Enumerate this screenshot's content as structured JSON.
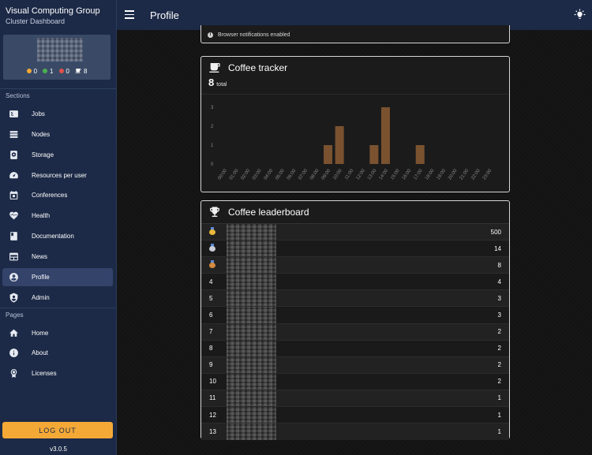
{
  "sidebar": {
    "title": "Visual Computing Group",
    "subtitle": "Cluster Dashboard",
    "status": [
      {
        "icon": "orange-dot",
        "color": "#f4a936",
        "value": "0"
      },
      {
        "icon": "green-dot",
        "color": "#4caf50",
        "value": "1"
      },
      {
        "icon": "red-dot",
        "color": "#e0504a",
        "value": "0"
      },
      {
        "icon": "coffee-icon",
        "value": "8"
      }
    ],
    "sections_label": "Sections",
    "sections": [
      {
        "label": "Jobs",
        "icon": "jobs-icon"
      },
      {
        "label": "Nodes",
        "icon": "nodes-icon"
      },
      {
        "label": "Storage",
        "icon": "storage-icon"
      },
      {
        "label": "Resources per user",
        "icon": "gauge-icon"
      },
      {
        "label": "Conferences",
        "icon": "calendar-icon"
      },
      {
        "label": "Health",
        "icon": "heart-pulse-icon"
      },
      {
        "label": "Documentation",
        "icon": "book-icon"
      },
      {
        "label": "News",
        "icon": "news-icon"
      },
      {
        "label": "Profile",
        "icon": "account-circle-icon"
      },
      {
        "label": "Admin",
        "icon": "shield-icon"
      }
    ],
    "pages_label": "Pages",
    "pages": [
      {
        "label": "Home",
        "icon": "home-icon"
      },
      {
        "label": "About",
        "icon": "info-icon"
      },
      {
        "label": "Licenses",
        "icon": "certificate-icon"
      }
    ],
    "logout_label": "LOG OUT",
    "version": "v3.0.5"
  },
  "header": {
    "title": "Profile",
    "menu_icon": "menu-icon",
    "theme_icon": "lightbulb-icon"
  },
  "notifications": {
    "text": "Browser notifications enabled"
  },
  "coffee_tracker": {
    "title": "Coffee tracker",
    "total": "8",
    "total_label": "total"
  },
  "chart_data": {
    "type": "bar",
    "title": "",
    "xlabel": "",
    "ylabel": "",
    "ylim": [
      0,
      3
    ],
    "yticks": [
      0,
      1,
      2,
      3
    ],
    "categories": [
      "00:00",
      "01:00",
      "02:00",
      "03:00",
      "04:00",
      "05:00",
      "06:00",
      "07:00",
      "08:00",
      "09:00",
      "10:00",
      "11:00",
      "12:00",
      "13:00",
      "14:00",
      "15:00",
      "16:00",
      "17:00",
      "18:00",
      "19:00",
      "20:00",
      "21:00",
      "22:00",
      "23:00"
    ],
    "values": [
      0,
      0,
      0,
      0,
      0,
      0,
      0,
      0,
      0,
      1,
      2,
      0,
      0,
      1,
      3,
      0,
      0,
      1,
      0,
      0,
      0,
      0,
      0,
      0
    ],
    "bar_color": "#7a5230",
    "grid": false
  },
  "leaderboard": {
    "title": "Coffee leaderboard",
    "rows": [
      {
        "rank": "1",
        "medal": "gold-medal-icon",
        "medal_color": "#e8b93a",
        "count": "500"
      },
      {
        "rank": "2",
        "medal": "silver-medal-icon",
        "medal_color": "#c9ced6",
        "count": "14"
      },
      {
        "rank": "3",
        "medal": "bronze-medal-icon",
        "medal_color": "#d28a3e",
        "count": "8"
      },
      {
        "rank": "4",
        "count": "4"
      },
      {
        "rank": "5",
        "count": "3"
      },
      {
        "rank": "6",
        "count": "3"
      },
      {
        "rank": "7",
        "count": "2"
      },
      {
        "rank": "8",
        "count": "2"
      },
      {
        "rank": "9",
        "count": "2"
      },
      {
        "rank": "10",
        "count": "2"
      },
      {
        "rank": "11",
        "count": "1"
      },
      {
        "rank": "12",
        "count": "1"
      },
      {
        "rank": "13",
        "count": "1"
      }
    ]
  }
}
